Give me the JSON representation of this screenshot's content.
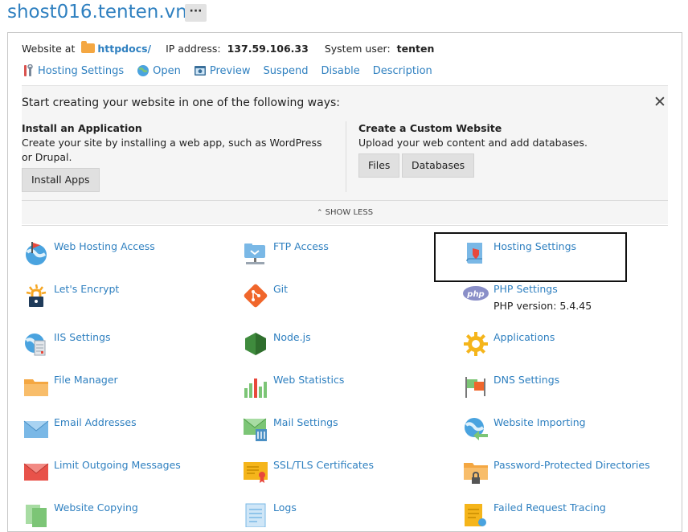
{
  "header": {
    "domain": "shost016.tenten.vn",
    "more_label": "···"
  },
  "info": {
    "website_at_label": "Website at",
    "docroot": "httpdocs/",
    "ip_label": "IP address:",
    "ip_value": "137.59.106.33",
    "user_label": "System user:",
    "user_value": "tenten"
  },
  "actions": [
    {
      "label": "Hosting Settings",
      "icon": "tools-icon"
    },
    {
      "label": "Open",
      "icon": "globe-icon"
    },
    {
      "label": "Preview",
      "icon": "preview-icon"
    },
    {
      "label": "Suspend"
    },
    {
      "label": "Disable"
    },
    {
      "label": "Description"
    }
  ],
  "start": {
    "title": "Start creating your website in one of the following ways:",
    "app_title": "Install an Application",
    "app_desc": "Create your site by installing a web app, such as WordPress or Drupal.",
    "install_btn": "Install Apps",
    "custom_title": "Create a Custom Website",
    "custom_desc": "Upload your web content and add databases.",
    "files_btn": "Files",
    "databases_btn": "Databases",
    "show_less": "SHOW LESS"
  },
  "tools": [
    {
      "label": "Web Hosting Access",
      "icon": "web-hosting-access-icon"
    },
    {
      "label": "FTP Access",
      "icon": "ftp-access-icon"
    },
    {
      "label": "Hosting Settings",
      "icon": "hosting-settings-icon"
    },
    {
      "label": "Let's Encrypt",
      "icon": "lets-encrypt-icon"
    },
    {
      "label": "Git",
      "icon": "git-icon"
    },
    {
      "label": "PHP Settings",
      "icon": "php-icon",
      "sub": "PHP version: 5.4.45"
    },
    {
      "label": "IIS Settings",
      "icon": "iis-settings-icon"
    },
    {
      "label": "Node.js",
      "icon": "nodejs-icon"
    },
    {
      "label": "Applications",
      "icon": "applications-gear-icon"
    },
    {
      "label": "File Manager",
      "icon": "file-manager-folder-icon"
    },
    {
      "label": "Web Statistics",
      "icon": "web-statistics-icon"
    },
    {
      "label": "DNS Settings",
      "icon": "dns-settings-icon"
    },
    {
      "label": "Email Addresses",
      "icon": "email-addresses-icon"
    },
    {
      "label": "Mail Settings",
      "icon": "mail-settings-icon"
    },
    {
      "label": "Website Importing",
      "icon": "website-importing-icon"
    },
    {
      "label": "Limit Outgoing Messages",
      "icon": "limit-outgoing-messages-icon"
    },
    {
      "label": "SSL/TLS Certificates",
      "icon": "ssl-certificate-icon"
    },
    {
      "label": "Password-Protected Directories",
      "icon": "password-protected-directories-icon"
    },
    {
      "label": "Website Copying",
      "icon": "website-copying-icon"
    },
    {
      "label": "Logs",
      "icon": "logs-icon"
    },
    {
      "label": "Failed Request Tracing",
      "icon": "failed-request-tracing-icon"
    }
  ]
}
